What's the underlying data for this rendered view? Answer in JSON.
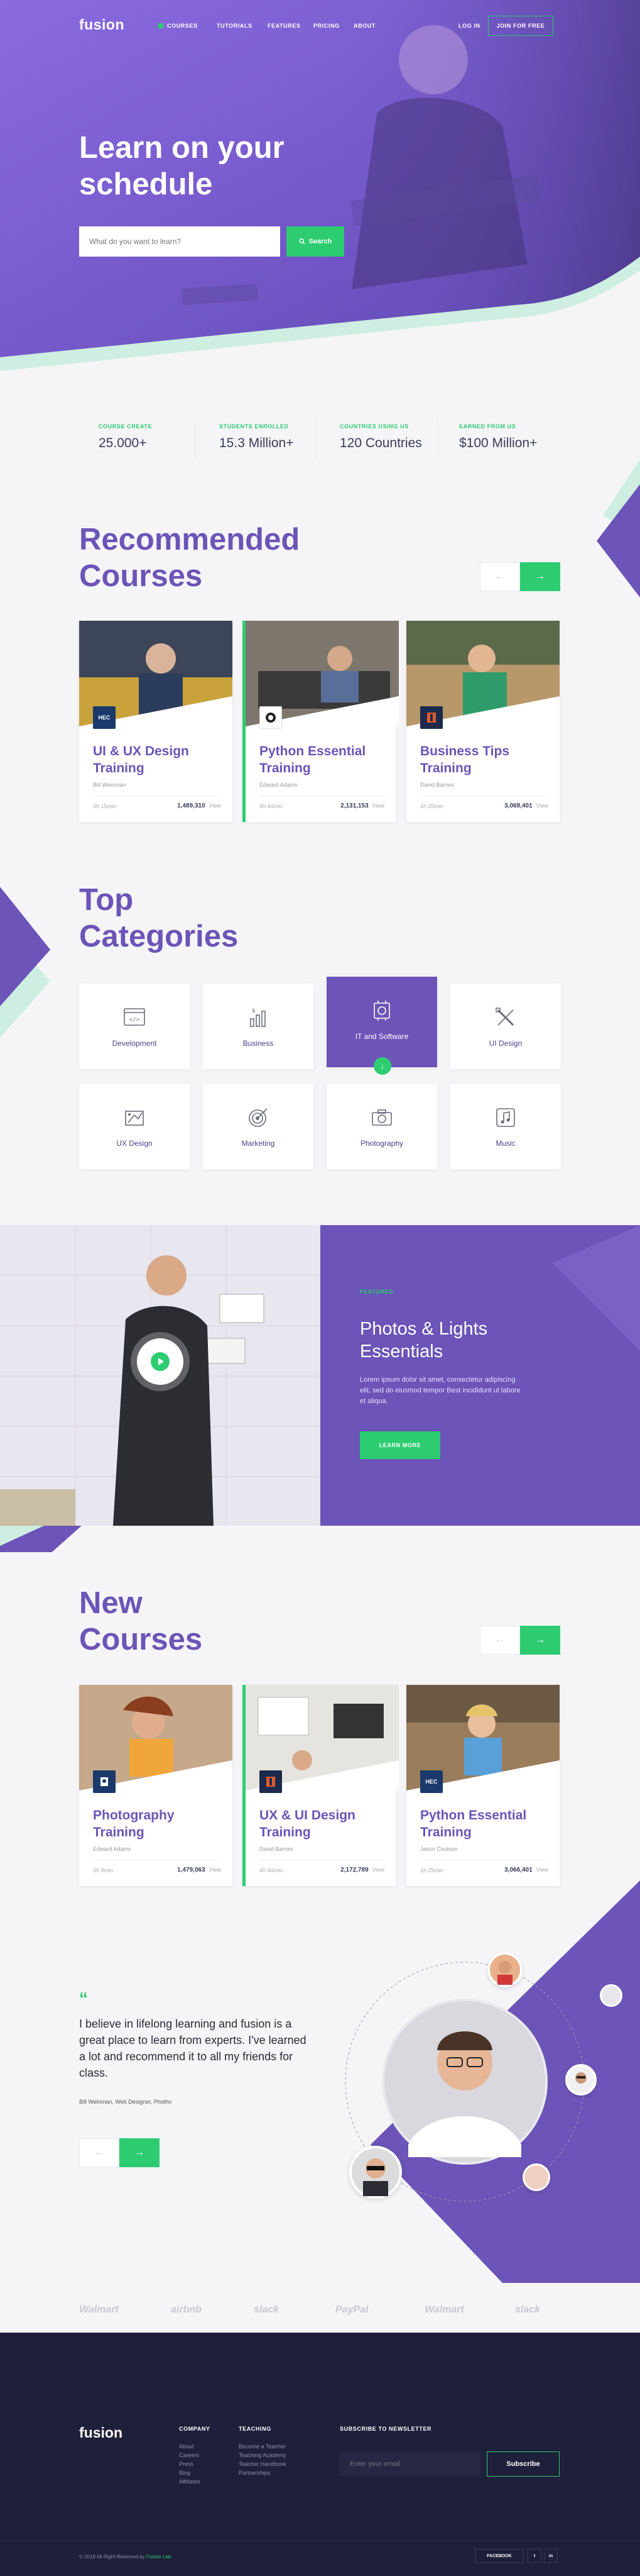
{
  "header": {
    "logo": "fusion",
    "nav": [
      "COURSES",
      "TUTORIALS",
      "FEATURES",
      "PRICING",
      "ABOUT"
    ],
    "login": "LOG IN",
    "join": "JOIN FOR FREE"
  },
  "hero": {
    "title": "Learn on your schedule",
    "search_placeholder": "What do you want to learn?",
    "search_button": "Search"
  },
  "stats": [
    {
      "label": "COURSE CREATE",
      "value": "25.000+"
    },
    {
      "label": "STUDENTS ENROLLED",
      "value": "15.3 Million+"
    },
    {
      "label": "COUNTRIES USING US",
      "value": "120 Countries"
    },
    {
      "label": "EARNED FROM US",
      "value": "$100 Million+"
    }
  ],
  "recommended": {
    "title_line1": "Recommended",
    "title_line2": "Courses",
    "cards": [
      {
        "title": "UI & UX Design Training",
        "author": "Bill Weinman",
        "duration": "3h 15min",
        "views": "1,489,310",
        "views_label": "View",
        "badge": "HEC"
      },
      {
        "title": "Python Essential Training",
        "author": "Edward Adams",
        "duration": "4h 44min",
        "views": "2,131,153",
        "views_label": "View",
        "badge": ""
      },
      {
        "title": "Business Tips Training",
        "author": "David Barnes",
        "duration": "1h 20min",
        "views": "3,068,401",
        "views_label": "View",
        "badge": ""
      }
    ]
  },
  "categories": {
    "title_line1": "Top",
    "title_line2": "Categories",
    "items": [
      "Development",
      "Business",
      "IT and Software",
      "UI Design",
      "UX Design",
      "Marketing",
      "Photography",
      "Music"
    ]
  },
  "promo": {
    "tag": "FEATURED",
    "title": "Photos & Lights Essentials",
    "text": "Lorem ipsum dolor sit amet, consectetur adipiscing elit, sed do eiusmod tempor Best incididunt ut labore et aliqua.",
    "button": "LEARN MORE"
  },
  "new_courses": {
    "title_line1": "New",
    "title_line2": "Courses",
    "cards": [
      {
        "title": "Photography Training",
        "author": "Edward Adams",
        "duration": "3h 8min",
        "views": "1,479,063",
        "views_label": "View",
        "badge": ""
      },
      {
        "title": "UX & UI Design Training",
        "author": "David Barnes",
        "duration": "4h 44min",
        "views": "2,172,789",
        "views_label": "View",
        "badge": ""
      },
      {
        "title": "Python Essential Training",
        "author": "Jason Coulson",
        "duration": "1h 25min",
        "views": "3,066,401",
        "views_label": "View",
        "badge": "HEC"
      }
    ]
  },
  "testimonial": {
    "mark": "“",
    "quote": "I believe in lifelong learning and fusion is a great place to learn from experts. I've learned a lot and recommend it to all my friends for class.",
    "by": "Bill Weinman, Web Designer, Phothn"
  },
  "brands": [
    "Walmart",
    "airbnb",
    "slack",
    "PayPal",
    "Walmart",
    "slack"
  ],
  "footer": {
    "logo": "fusion",
    "company_heading": "COMPANY",
    "company_links": [
      "About",
      "Careers",
      "Press",
      "Blog",
      "Affiliates"
    ],
    "teaching_heading": "TEACHING",
    "teaching_links": [
      "Become a Teacher",
      "Teaching Academy",
      "Teacher Handbook",
      "Partnerships"
    ],
    "newsletter_heading": "SUBSCRIBE TO NEWSLETTER",
    "email_placeholder": "Enter your email",
    "subscribe": "Subscribe",
    "copyright_prefix": "© 2019 All Right Reserved by",
    "copyright_brand": "Fusion Lab",
    "social": [
      "FACEBOOK",
      "t",
      "in"
    ]
  },
  "colors": {
    "purple": "#6c54b8",
    "green": "#2ecc71",
    "dark": "#1e1f3a"
  }
}
